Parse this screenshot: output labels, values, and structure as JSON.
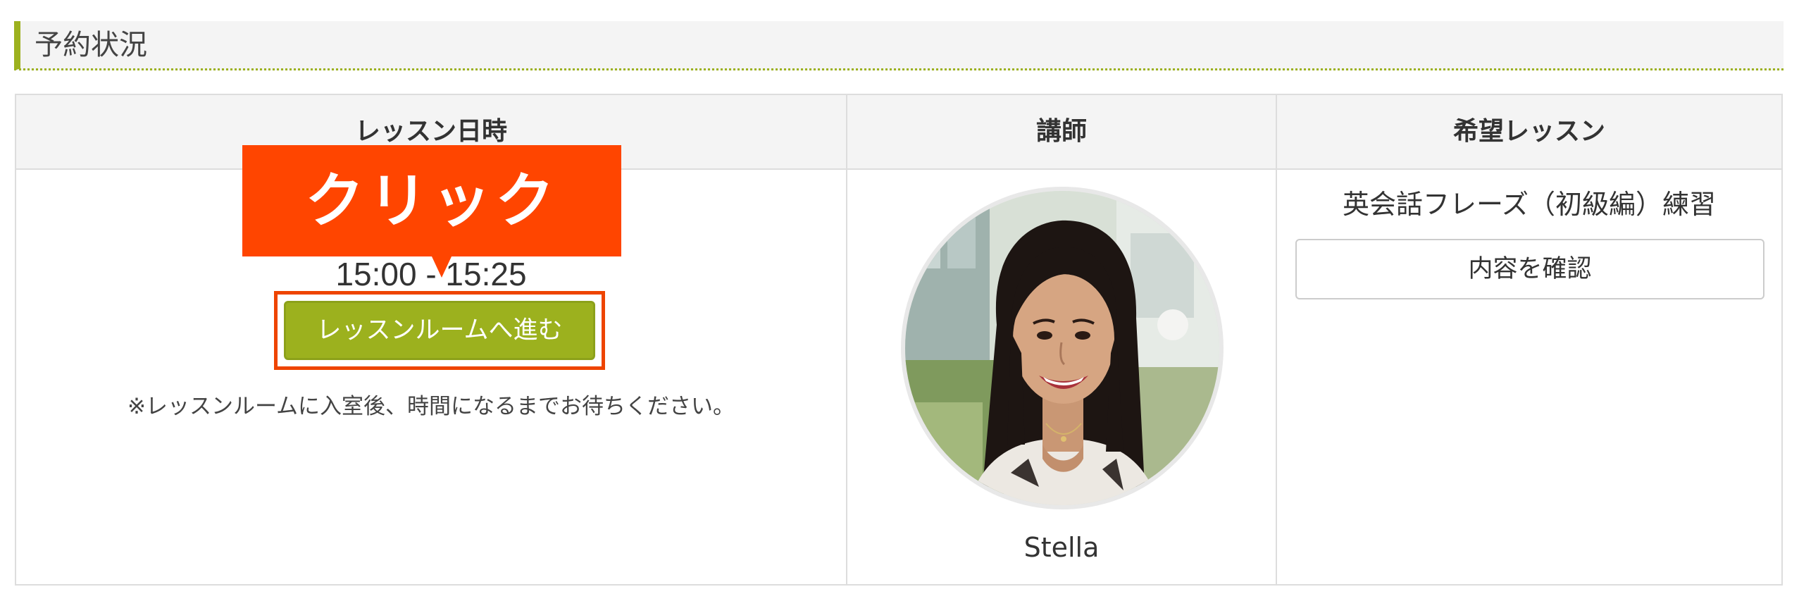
{
  "section": {
    "title": "予約状況"
  },
  "table": {
    "headers": {
      "datetime": "レッスン日時",
      "teacher": "講師",
      "lesson": "希望レッスン"
    }
  },
  "reservation": {
    "time_range": "15:00 - 15:25",
    "enter_room_label": "レッスンルームへ進む",
    "note": "※レッスンルームに入室後、時間になるまでお待ちください。"
  },
  "teacher": {
    "name": "Stella"
  },
  "lesson": {
    "name": "英会話フレーズ（初級編）練習",
    "confirm_label": "内容を確認"
  },
  "callout": {
    "text": "クリック"
  },
  "colors": {
    "accent_green": "#9cb11e",
    "callout_orange": "#ff4500"
  }
}
